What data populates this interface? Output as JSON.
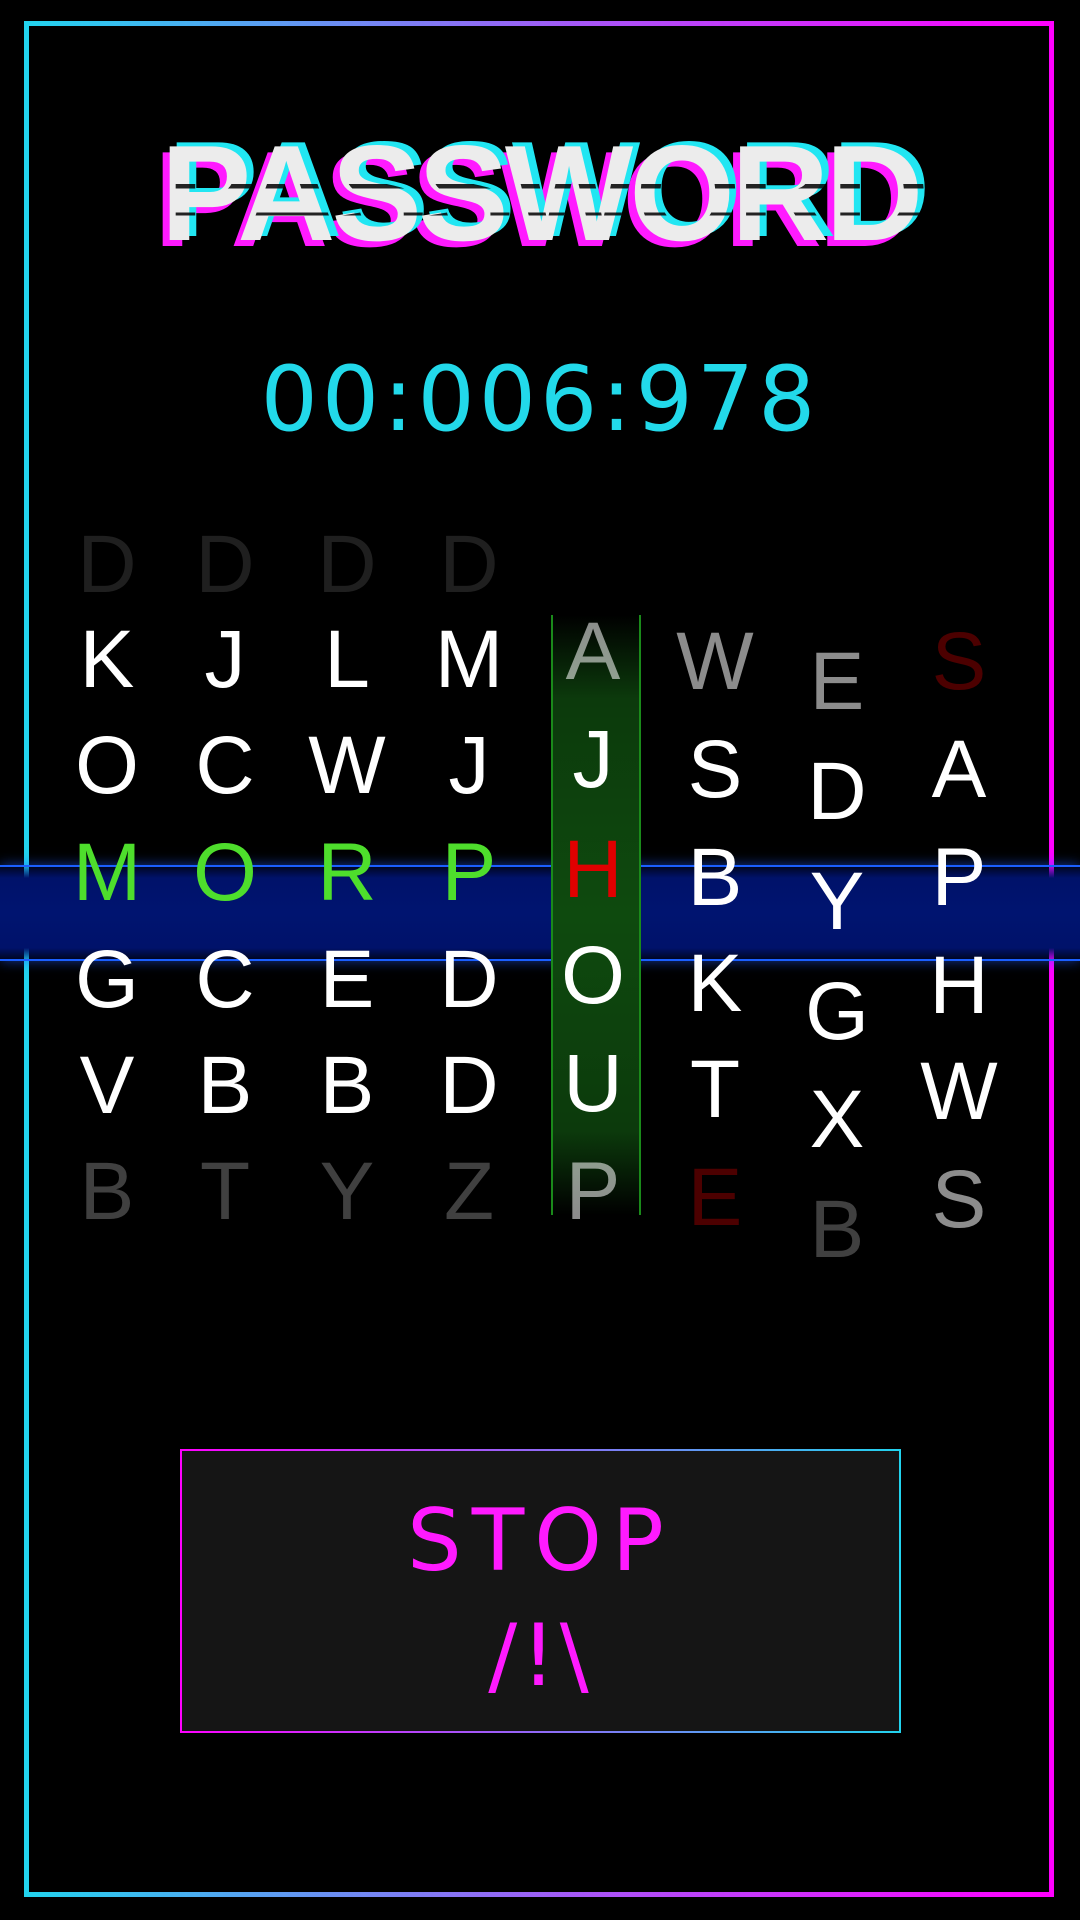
{
  "title": "PASSWORD",
  "timer": "00:006:978",
  "reels": [
    {
      "letters": [
        "D",
        "K",
        "O",
        "M",
        "G",
        "V",
        "B"
      ],
      "states": [
        "fade3",
        "",
        "",
        "win",
        "",
        "",
        "fade2"
      ]
    },
    {
      "letters": [
        "D",
        "J",
        "C",
        "O",
        "C",
        "B",
        "T"
      ],
      "states": [
        "fade3",
        "",
        "",
        "win",
        "",
        "",
        "fade2"
      ]
    },
    {
      "letters": [
        "D",
        "L",
        "W",
        "R",
        "E",
        "B",
        "Y"
      ],
      "states": [
        "fade3",
        "",
        "",
        "win",
        "",
        "",
        "fade2"
      ]
    },
    {
      "letters": [
        "D",
        "M",
        "J",
        "P",
        "D",
        "D",
        "Z"
      ],
      "states": [
        "fade3",
        "",
        "",
        "win",
        "",
        "",
        "fade2"
      ]
    },
    {
      "letters": [
        "A",
        "J",
        "H",
        "O",
        "U",
        "P"
      ],
      "states": [
        "fade1",
        "",
        "miss",
        "",
        "",
        "fade1"
      ]
    },
    {
      "letters": [
        "W",
        "S",
        "B",
        "K",
        "T",
        "E"
      ],
      "states": [
        "fade1",
        "",
        "",
        "",
        "",
        "missdim"
      ]
    },
    {
      "letters": [
        "E",
        "D",
        "Y",
        "G",
        "X",
        "B"
      ],
      "states": [
        "fade1",
        "",
        "",
        "",
        "",
        "fade2"
      ]
    },
    {
      "letters": [
        "S",
        "A",
        "P",
        "H",
        "W",
        "S"
      ],
      "states": [
        "missdim",
        "",
        "",
        "",
        "",
        "fade1"
      ]
    }
  ],
  "stop_button": {
    "label": "STOP",
    "icon_text": "/!\\"
  },
  "colors": {
    "accent_cyan": "#22d9ea",
    "accent_magenta": "#ff1aff",
    "match_green": "#4ede2c",
    "miss_red": "#e00000",
    "row_blue": "#001470"
  }
}
